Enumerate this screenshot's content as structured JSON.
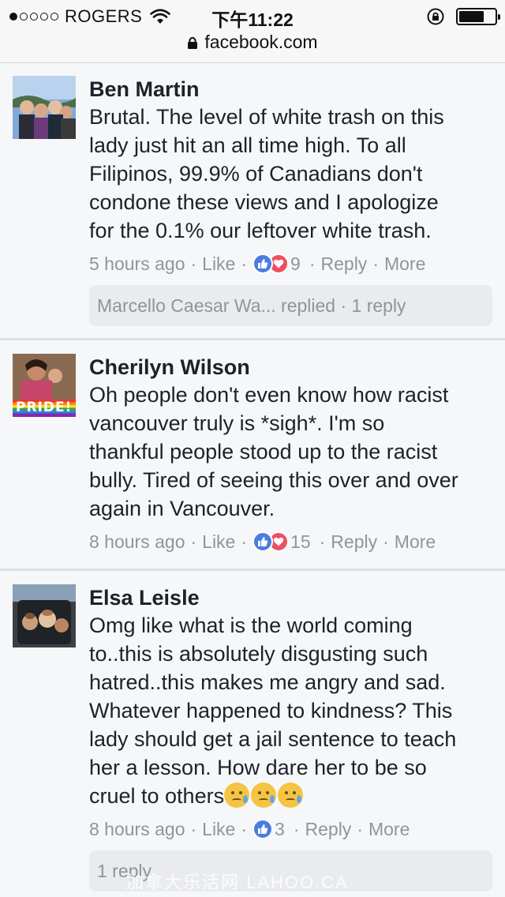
{
  "status_bar": {
    "carrier": "ROGERS",
    "time": "下午11:22",
    "url": "facebook.com",
    "signal_dots_filled": 1,
    "signal_dots_total": 5
  },
  "comments": [
    {
      "name": "Ben Martin",
      "text_lines": [
        "Brutal. The level of white trash on this",
        "lady just hit an all time high. To all",
        "Filipinos, 99.9% of Canadians don't",
        "condone these views and I apologize",
        "for the 0.1% our leftover white trash."
      ],
      "time": "5 hours ago",
      "like_label": "Like",
      "reaction_count": "9",
      "reply_label": "Reply",
      "more_label": "More",
      "replies_preview": "Marcello Caesar Wa... replied · 1 reply"
    },
    {
      "name": "Cherilyn Wilson",
      "text_lines": [
        "Oh people don't even know how racist",
        "vancouver truly is *sigh*. I'm so",
        "thankful people stood up to the racist",
        "bully. Tired of seeing this over and over",
        "again in Vancouver."
      ],
      "time": "8 hours ago",
      "like_label": "Like",
      "reaction_count": "15",
      "reply_label": "Reply",
      "more_label": "More",
      "avatar_text": "PRIDE!"
    },
    {
      "name": "Elsa Leisle",
      "text_lines": [
        "Omg like what is the world coming",
        "to..this is absolutely disgusting such",
        "hatred..this makes me angry and sad.",
        "Whatever happened to kindness? This",
        "lady should get a jail sentence to teach",
        "her a lesson. How dare her to be so",
        "cruel to others"
      ],
      "time": "8 hours ago",
      "like_label": "Like",
      "reaction_count": "3",
      "reply_label": "Reply",
      "more_label": "More",
      "replies_preview": "1 reply"
    }
  ],
  "watermark": "加拿大乐活网   LAHOO.CA",
  "colors": {
    "link_gray": "#90949c",
    "like_blue": "#4a7de0",
    "love_red": "#ef4f60",
    "background": "#f6f7f9"
  }
}
